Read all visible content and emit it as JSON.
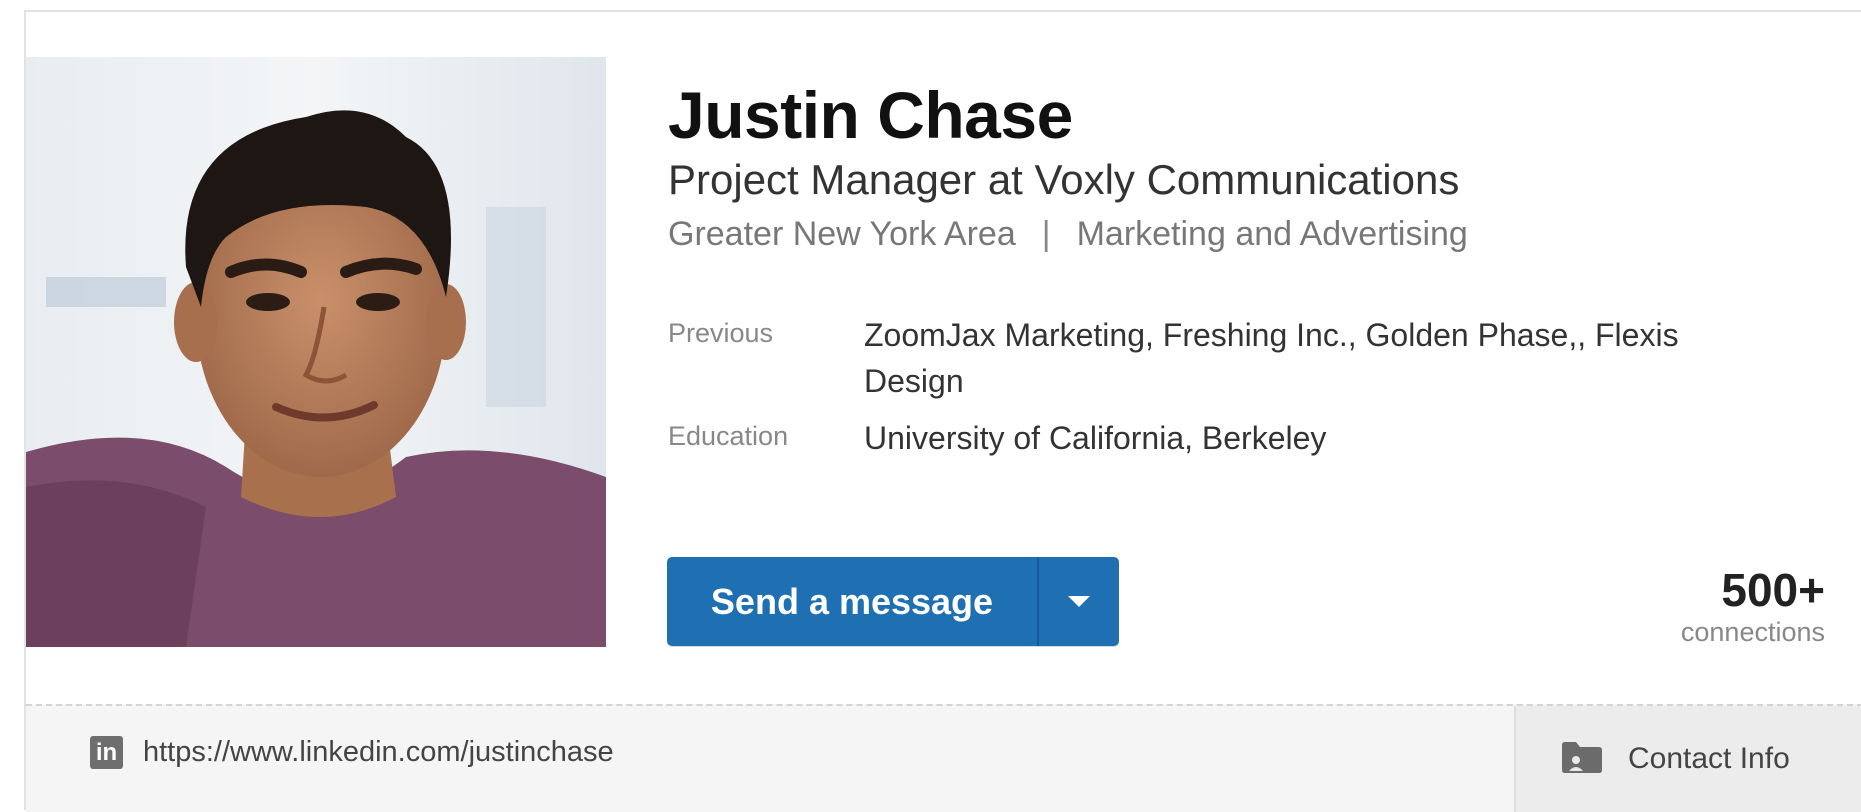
{
  "profile": {
    "name": "Justin Chase",
    "headline": "Project Manager at Voxly Communications",
    "location": "Greater New York Area",
    "separator": "|",
    "industry": "Marketing and Advertising",
    "previous_label": "Previous",
    "previous_value": "ZoomJax Marketing, Freshing Inc., Golden Phase,, Flexis Design",
    "education_label": "Education",
    "education_value": "University of California, Berkeley"
  },
  "actions": {
    "send_message_label": "Send a message",
    "dropdown_icon": "caret-down-icon"
  },
  "connections": {
    "count": "500+",
    "label": "connections"
  },
  "footer": {
    "linkedin_icon": "linkedin-icon",
    "linkedin_icon_text": "in",
    "profile_url": "https://www.linkedin.com/justinchase",
    "contact_icon": "folder-contact-icon",
    "contact_label": "Contact Info"
  },
  "colors": {
    "button_blue": "#1f6fb3",
    "name_text": "#111111",
    "muted_text": "#777777"
  }
}
